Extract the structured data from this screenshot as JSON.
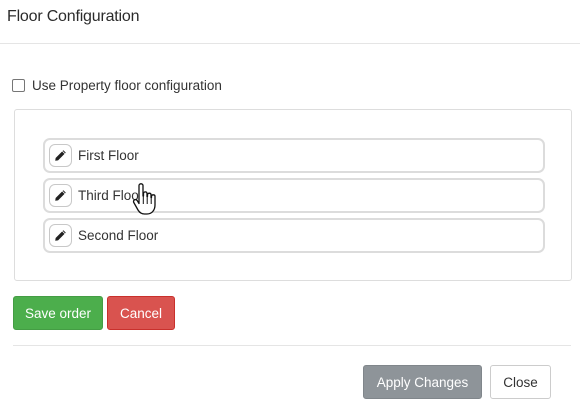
{
  "modal": {
    "title": "Floor Configuration"
  },
  "property_config": {
    "checkbox_label": "Use Property floor configuration",
    "checked": false
  },
  "floors": [
    {
      "label": "First Floor",
      "edit_icon": "pencil-icon"
    },
    {
      "label": "Third Floor",
      "edit_icon": "pencil-icon"
    },
    {
      "label": "Second Floor",
      "edit_icon": "pencil-icon"
    }
  ],
  "order_actions": {
    "save_label": "Save order",
    "cancel_label": "Cancel"
  },
  "footer": {
    "apply_label": "Apply Changes",
    "close_label": "Close"
  },
  "cursor": {
    "icon": "hand-pointer-icon"
  },
  "colors": {
    "save": "#4cae4c",
    "cancel": "#d9534f",
    "apply": "#8e9499"
  }
}
